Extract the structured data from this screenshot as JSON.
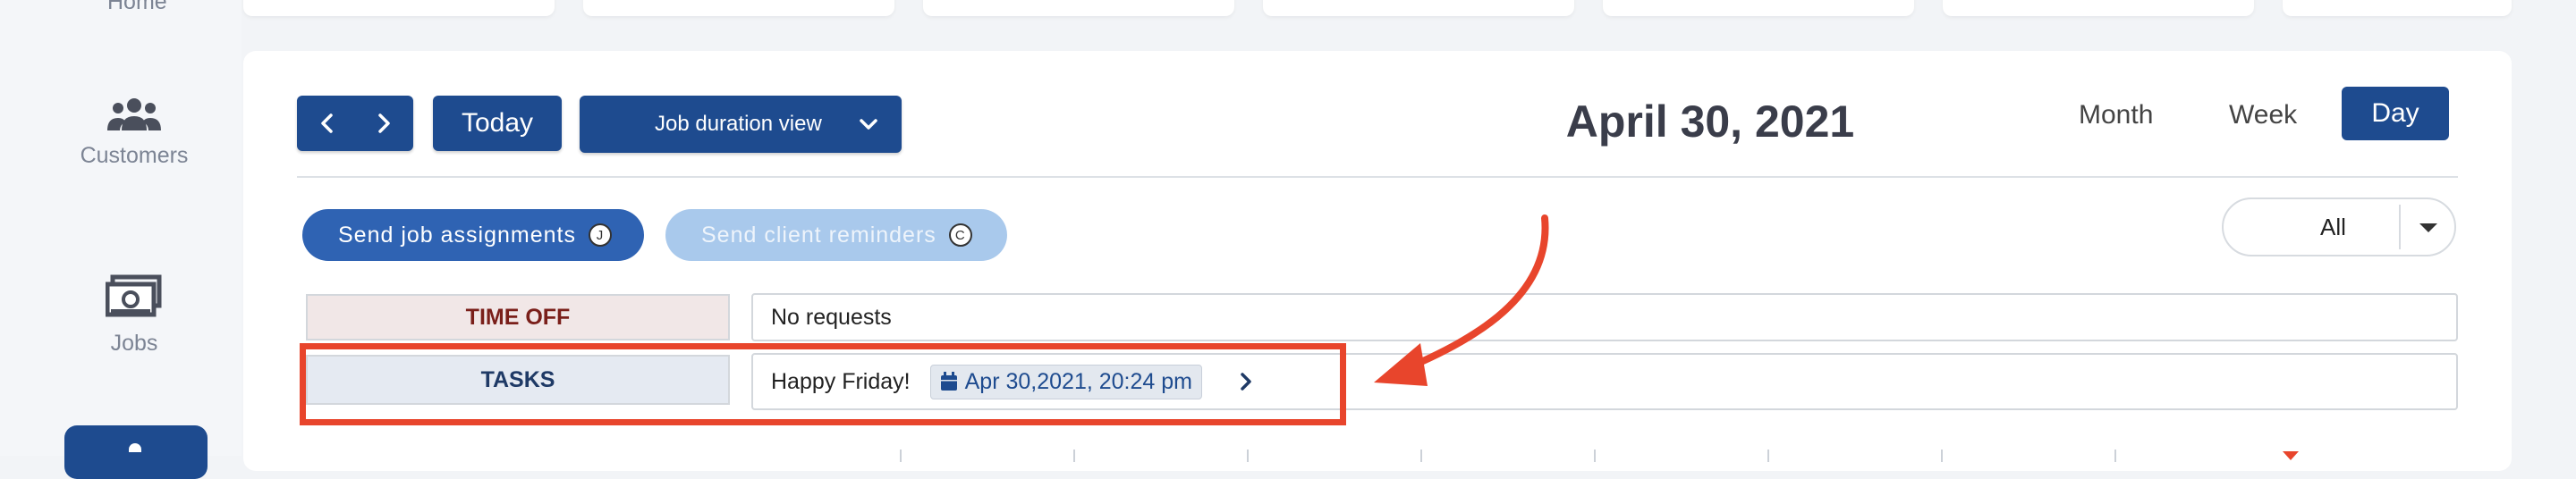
{
  "sidebar": {
    "items": [
      {
        "label": "Home",
        "icon": "home-icon"
      },
      {
        "label": "Customers",
        "icon": "customers-icon"
      },
      {
        "label": "Jobs",
        "icon": "jobs-icon"
      }
    ]
  },
  "toolbar": {
    "prev_icon": "chevron-left-icon",
    "next_icon": "chevron-right-icon",
    "today_label": "Today",
    "view_select_label": "Job duration view",
    "current_date": "April 30, 2021"
  },
  "view_tabs": {
    "month": "Month",
    "week": "Week",
    "day": "Day",
    "active": "Day"
  },
  "actions": {
    "send_assignments": {
      "label": "Send job assignments",
      "key": "J"
    },
    "send_reminders": {
      "label": "Send client reminders",
      "key": "C"
    }
  },
  "filter": {
    "selected": "All"
  },
  "rows": {
    "time_off": {
      "label": "TIME OFF",
      "value": "No requests"
    },
    "tasks": {
      "label": "TASKS",
      "task_text": "Happy Friday!",
      "task_date": "Apr 30,2021, 20:24 pm"
    }
  },
  "colors": {
    "primary": "#1e4b8f",
    "accent_light": "#a9c9ec",
    "time_off_bg": "#f1e7e7",
    "time_off_text": "#7a1f1a",
    "tasks_bg": "#e5eaf2",
    "annotation": "#e8452c"
  }
}
